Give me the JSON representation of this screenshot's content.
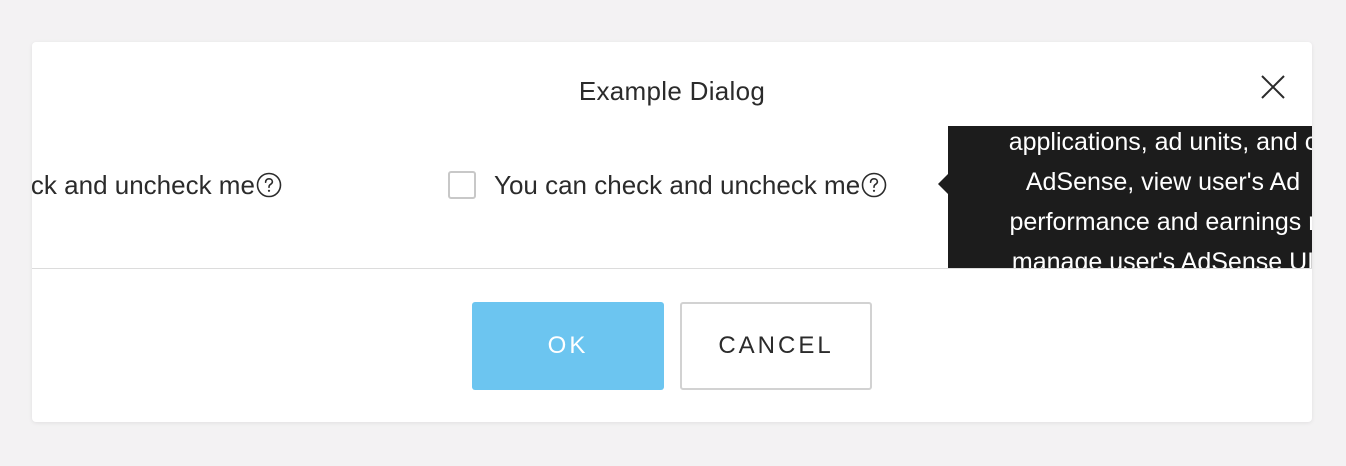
{
  "dialog": {
    "title": "Example Dialog",
    "close_icon": "close-icon"
  },
  "body": {
    "checkbox_rows": [
      {
        "label": "You can check and uncheck me",
        "visible_label": "heck and uncheck me",
        "checked": false,
        "help_icon": "help-circle-icon"
      },
      {
        "label": "You can check and uncheck me",
        "checked": false,
        "help_icon": "help-circle-icon"
      }
    ],
    "tooltip": {
      "lines": [
        "applications, ad units, and c",
        "AdSense, view user's Ad",
        "performance and earnings r",
        "manage user's AdSense UI"
      ]
    }
  },
  "footer": {
    "ok_label": "OK",
    "cancel_label": "CANCEL"
  },
  "colors": {
    "page_background": "#f3f2f3",
    "primary_button": "#6cc5f0",
    "tooltip_background": "#1c1c1c"
  }
}
